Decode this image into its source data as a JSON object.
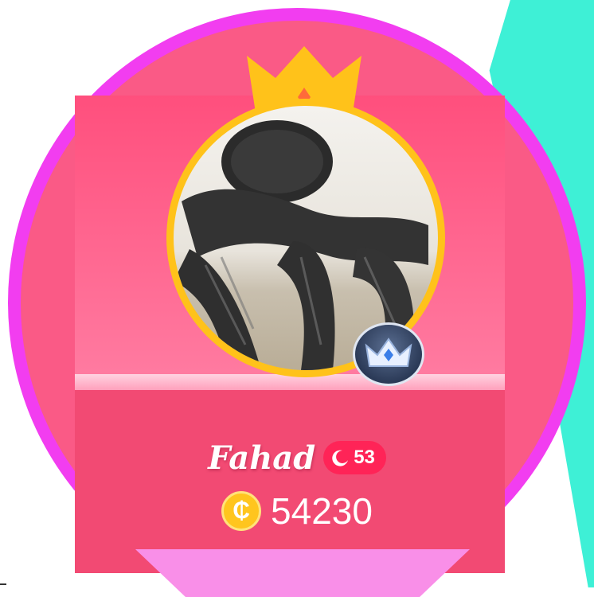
{
  "profile": {
    "name": "Fahad",
    "level": "53",
    "coins": "54230",
    "coin_symbol": "₵"
  },
  "icons": {
    "crown": "crown-icon",
    "vip_badge": "vip-crown-badge-icon",
    "level": "crescent-moon-icon",
    "coin": "coin-icon"
  },
  "colors": {
    "ring": "#f23df0",
    "card": "#ff4f7d",
    "band": "#f24a73",
    "crown": "#ffc21a",
    "teal": "#3ef0d6",
    "level_pill": "#ff2457"
  }
}
